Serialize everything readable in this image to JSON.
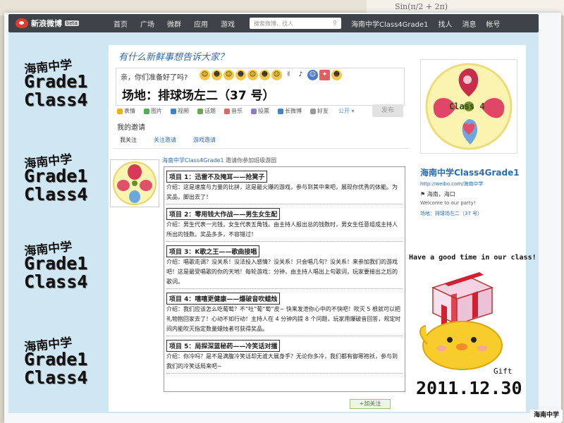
{
  "nav": {
    "logo": "新浪微博",
    "beta": "beta",
    "items": [
      "首页",
      "广场",
      "微群",
      "应用",
      "游戏"
    ],
    "search_placeholder": "搜索微博、找人",
    "user": "海南中学Class4Grade1",
    "right_items": [
      "找人",
      "消息",
      "帐号"
    ]
  },
  "decorations": [
    {
      "cn": "海南中学",
      "line1": "Grade1",
      "line2": "Class4"
    },
    {
      "cn": "海南中学",
      "line1": "Grade1",
      "line2": "Class4"
    },
    {
      "cn": "海南中学",
      "line1": "Grade1",
      "line2": "Class4"
    },
    {
      "cn": "海南中学",
      "line1": "Grade1",
      "line2": "Class4"
    }
  ],
  "composer": {
    "prompt": "有什么新鲜事想告诉大家？",
    "greeting": "亲，你们准备好了吗?",
    "message": "场地：排球场左二（37 号）",
    "post_label": "发布",
    "public_label": "公开"
  },
  "toolbar": [
    {
      "label": "表情",
      "color": "#f0b400"
    },
    {
      "label": "图片",
      "color": "#4caf50"
    },
    {
      "label": "视频",
      "color": "#3f7fd8"
    },
    {
      "label": "话题",
      "color": "#6aa84f"
    },
    {
      "label": "音乐",
      "color": "#e06666"
    },
    {
      "label": "投票",
      "color": "#8e7cc3"
    },
    {
      "label": "长微博",
      "color": "#3d85c6"
    },
    {
      "label": "好友",
      "color": "#999999"
    }
  ],
  "invite": {
    "title": "我的邀请",
    "tabs": [
      "我关注",
      "关注邀请",
      "游戏邀请"
    ]
  },
  "feed": {
    "user": "海南中学Class4Grade1",
    "action": "邀请你参加班级游园"
  },
  "games": [
    {
      "title": "项目 1：迅雷不及掩耳——抢凳子",
      "desc": "介绍：这是速度与力量的比拼，这是最火爆的游戏，参与到其中来吧，展现你优秀的体能。为奖品，脚出去了！"
    },
    {
      "title": "项目 2：零用钱大作战——男生女生配",
      "desc": "介绍：男生代表一元钱，女生代表五角钱。由主持人报出总的钱数时，男女生任意组成主持人所出的钱数。奖品多多，不容错过！"
    },
    {
      "title": "项目 3：K歌之王——歌曲接唱",
      "desc": "介绍：唱歌走调？没关系！没法投入感情？没关系！只会唱几句？没关系！来参加我们的游戏吧！这是最受唱歌的你的天地！每轮游戏：分钟，由主持人唱出上句歌词，玩家要接出之后的歌词。"
    },
    {
      "title": "项目 4：嘻嘻更健康——爆破音吹蜡烛",
      "desc": "介绍：我们应该怎么吃葡萄？不“吐”葡“萄”皮~ 快来发泄你心中的不快吧！吹灭 5 根就可以把礼物抱回家去了！心动不如行动！主持人在 4 分钟内提 8 个问题，玩家用爆破音回答，规定时间内能吹灭指定数量蜡烛者可获得奖品。"
    },
    {
      "title": "项目 5：局探深蓝秘药——冷笑话对擂",
      "desc": "介绍：你冷吗？是不是满腹冷笑话却无谁大展身手？无论你多冷，我们都有御寒袍袄，参与到我们的冷笑话局来吧~"
    }
  ],
  "follow_label": "+加关注",
  "profile": {
    "avatar_text": "Class 4",
    "name": "海南中学Class4Grade1",
    "url": "http://weibo.com/海南中学",
    "location": "海南，海口",
    "welcome": "Welcome to our party!",
    "venue": "场地：排球场左二（37 号）"
  },
  "slogan": "Have a good time in our class!",
  "gift_label": "Gift",
  "date": "2011.12.30",
  "stamp": "海南中学",
  "desk_note": "Sin(π/2 + 2π)"
}
